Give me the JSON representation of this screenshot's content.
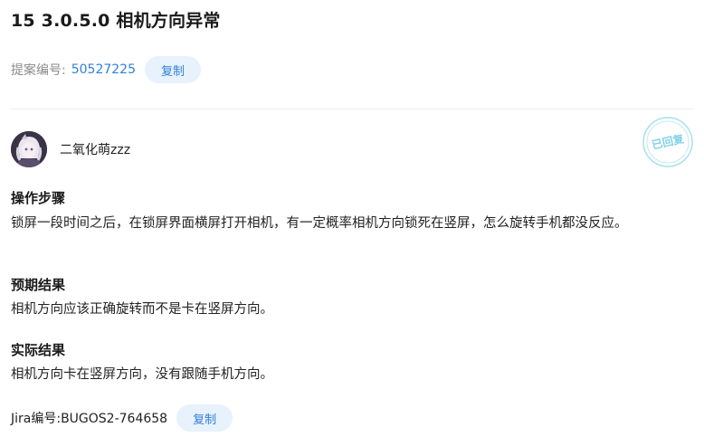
{
  "issue": {
    "title": "15 3.0.5.0 相机方向异常",
    "proposal_label": "提案编号:",
    "proposal_id": "50527225",
    "copy_label": "复制"
  },
  "author": {
    "name": "二氧化萌zzz"
  },
  "stamp": {
    "text": "已回复",
    "color": "#7fd1ea"
  },
  "sections": {
    "steps": {
      "title": "操作步骤",
      "body": "锁屏一段时间之后，在锁屏界面横屏打开相机，有一定概率相机方向锁死在竖屏，怎么旋转手机都没反应。"
    },
    "expected": {
      "title": "预期结果",
      "body": "相机方向应该正确旋转而不是卡在竖屏方向。"
    },
    "actual": {
      "title": "实际结果",
      "body": "相机方向卡在竖屏方向，没有跟随手机方向。"
    }
  },
  "jira": {
    "label": "Jira编号:BUGOS2-764658",
    "copy_label": "复制"
  },
  "colors": {
    "accent": "#2f7fdc",
    "button_bg": "#e8f2fd"
  }
}
